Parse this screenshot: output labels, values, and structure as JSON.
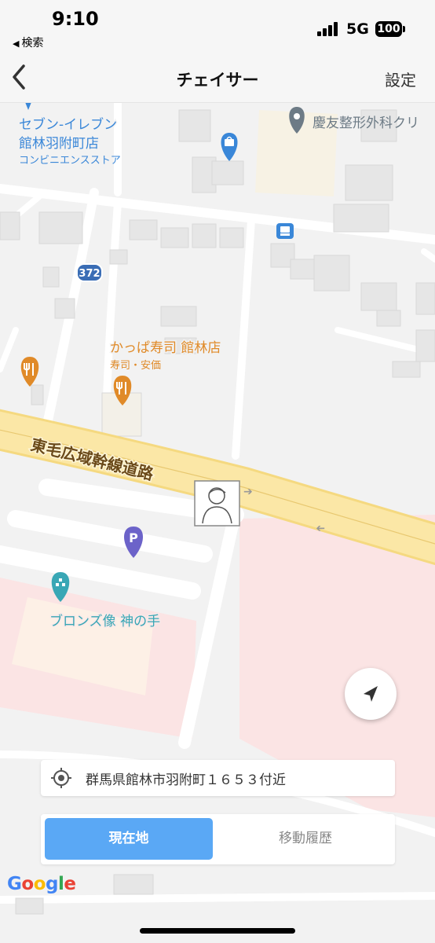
{
  "status_bar": {
    "time": "9:10",
    "back_app_label": "検索",
    "network": "5G",
    "battery": "100"
  },
  "nav": {
    "title": "チェイサー",
    "settings_label": "設定"
  },
  "map": {
    "places": [
      {
        "name": "セブン-イレブン\n館林羽附町店",
        "category": "コンビニエンスストア",
        "icon": "shopping-bag-icon",
        "color": "#3a87d8"
      },
      {
        "name": "慶友整形外科クリ",
        "icon": "place-pin-icon",
        "color": "#6d7b86"
      },
      {
        "name": "かっぱ寿司 館林店",
        "category": "寿司・安価",
        "icon": "restaurant-icon",
        "color": "#e08a28"
      },
      {
        "name": "ブロンズ像 神の手",
        "icon": "attraction-icon",
        "color": "#39a7b5"
      }
    ],
    "road_label": "東毛広域幹線道路",
    "route_shield": "372",
    "parking_label": "P",
    "colors": {
      "road": "#fbe7a6",
      "commercial": "#fbe4e4",
      "place_blue": "#3a87d8",
      "food_orange": "#e08a28"
    }
  },
  "address": {
    "text": "群馬県館林市羽附町１６５３付近",
    "icon": "gps-target-icon"
  },
  "tabs": {
    "current_label": "現在地",
    "history_label": "移動履歴",
    "active_color": "#5aa8f5"
  },
  "attribution": {
    "letters": [
      "G",
      "o",
      "o",
      "g",
      "l",
      "e"
    ],
    "colors": [
      "#4285f4",
      "#ea4335",
      "#fbbc05",
      "#4285f4",
      "#34a853",
      "#ea4335"
    ]
  }
}
